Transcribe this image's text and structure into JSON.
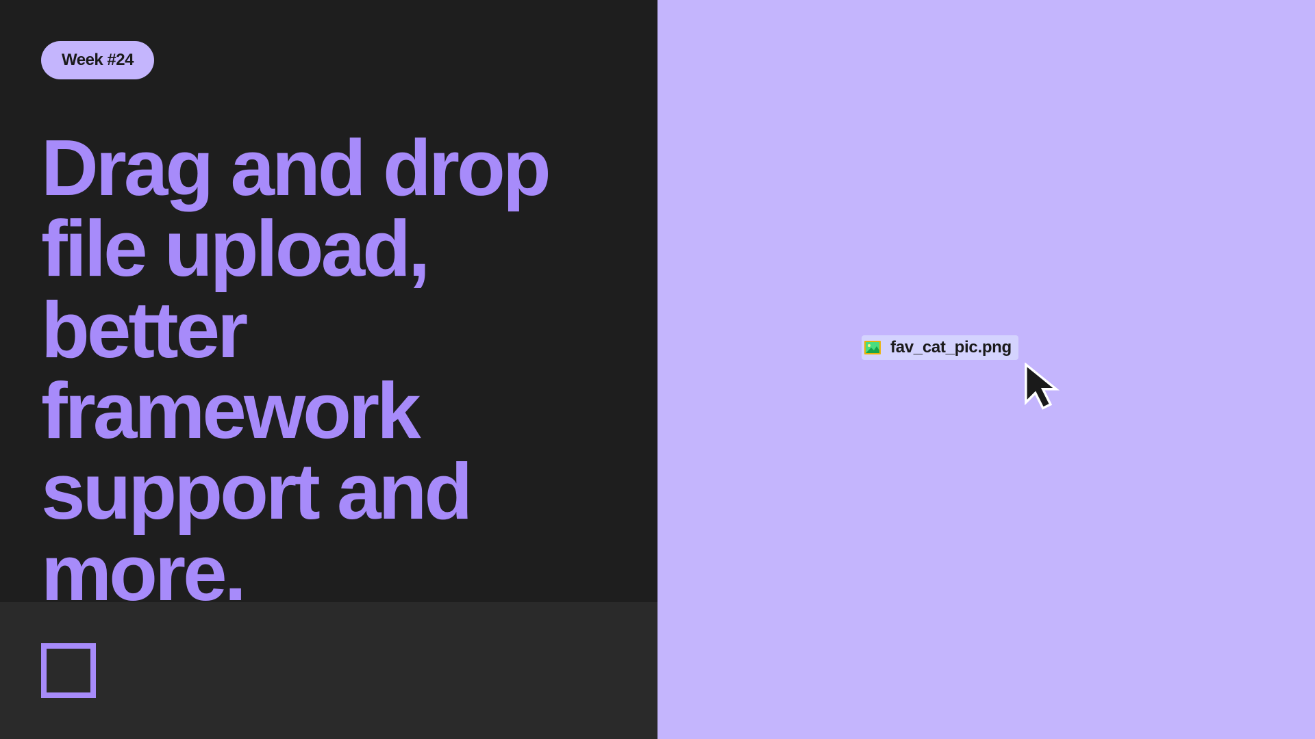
{
  "badge": {
    "label": "Week #24"
  },
  "headline": "Drag and drop file upload, better framework support and more.",
  "file": {
    "name": "fav_cat_pic.png"
  },
  "colors": {
    "accent": "#a78bfa",
    "accent_light": "#c4b5fd",
    "dark_bg": "#1e1e1e",
    "dark_footer": "#2a2a2a"
  }
}
